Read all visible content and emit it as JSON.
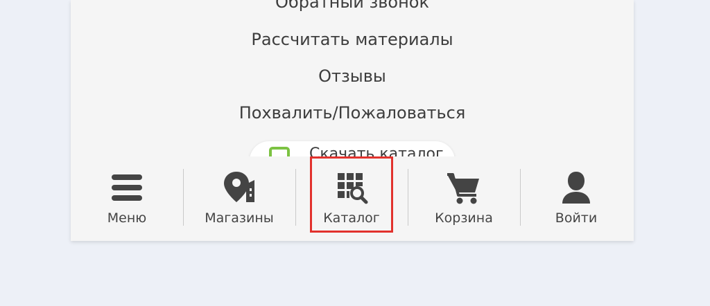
{
  "menu": {
    "links": [
      {
        "label": "Обратный звонок"
      },
      {
        "label": "Рассчитать материалы"
      },
      {
        "label": "Отзывы"
      },
      {
        "label": "Похвалить/Пожаловаться"
      }
    ],
    "catalog_button": {
      "label": "Скачать каталог",
      "icon": "catalog-download-icon",
      "accent": "#7cc242"
    }
  },
  "nav": {
    "items": [
      {
        "label": "Меню",
        "icon": "hamburger-icon"
      },
      {
        "label": "Магазины",
        "icon": "store-location-icon"
      },
      {
        "label": "Каталог",
        "icon": "catalog-search-icon",
        "selected": true
      },
      {
        "label": "Корзина",
        "icon": "cart-icon"
      },
      {
        "label": "Войти",
        "icon": "user-icon"
      }
    ],
    "highlight_color": "#e2322d"
  }
}
